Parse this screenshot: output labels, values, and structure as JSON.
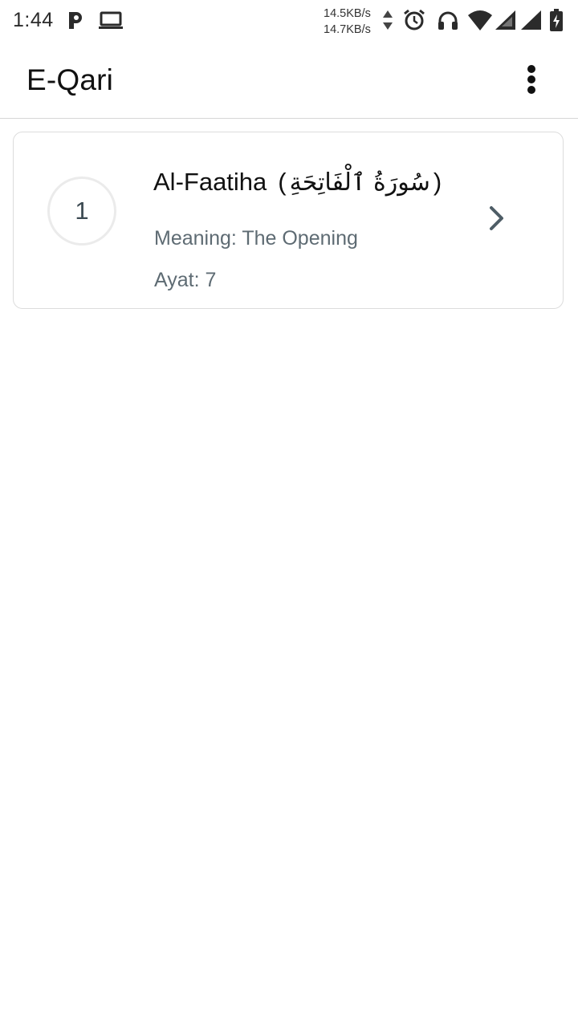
{
  "status_bar": {
    "time": "1:44",
    "speed_up": "14.5KB/s",
    "speed_down": "14.7KB/s",
    "icons": [
      "parking-notification-icon",
      "laptop-icon",
      "data-activity-icon",
      "alarm-icon",
      "headphones-icon",
      "wifi-icon",
      "signal-icon",
      "signal-icon",
      "battery-charging-icon"
    ]
  },
  "app_bar": {
    "title": "E-Qari",
    "menu_icon": "more-vert-icon"
  },
  "surahs": [
    {
      "number": "1",
      "name": "Al-Faatiha",
      "paren_open": "(",
      "arabic_name": "سُورَةُ ٱلْفَاتِحَةِ",
      "paren_close": ")",
      "meaning": "Meaning: The Opening",
      "ayat": "Ayat: 7",
      "action_icon": "chevron-right-icon"
    }
  ],
  "colors": {
    "subtitle": "#5e6b73",
    "chevron": "#4e5d66",
    "divider": "#d6d6d6",
    "card_border": "#dcdcdc"
  }
}
